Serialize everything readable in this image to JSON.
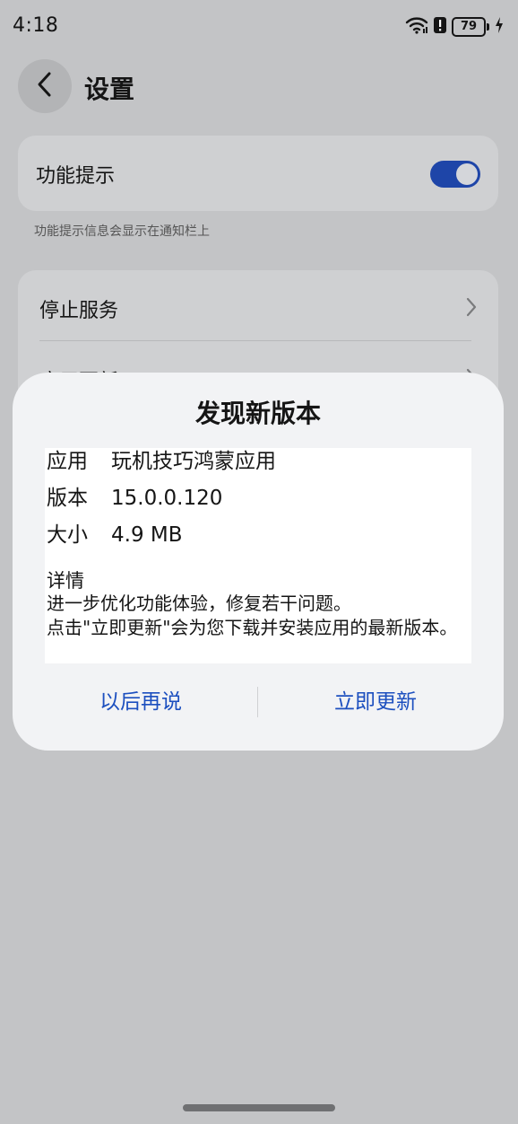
{
  "status_bar": {
    "time": "4:18",
    "battery": "79",
    "icons": [
      "wifi-icon",
      "alert-icon",
      "battery-icon",
      "charging-icon"
    ]
  },
  "header": {
    "title": "设置",
    "back_icon": "chevron-left-icon"
  },
  "feature_hint": {
    "label": "功能提示",
    "enabled": true,
    "caption": "功能提示信息会显示在通知栏上",
    "accent_color": "#1e45a8"
  },
  "menu": {
    "items": [
      {
        "label": "停止服务"
      },
      {
        "label": "应用更新"
      }
    ]
  },
  "dialog": {
    "title": "发现新版本",
    "rows": [
      {
        "key": "应用",
        "value": "玩机技巧鸿蒙应用"
      },
      {
        "key": "版本",
        "value": "15.0.0.120"
      },
      {
        "key": "大小",
        "value": "4.9 MB"
      }
    ],
    "details_title": "详情",
    "details_lines": [
      "进一步优化功能体验，修复若干问题。",
      "点击\"立即更新\"会为您下载并安装应用的最新版本。"
    ],
    "later_label": "以后再说",
    "update_label": "立即更新",
    "button_color": "#1c4fbf"
  }
}
